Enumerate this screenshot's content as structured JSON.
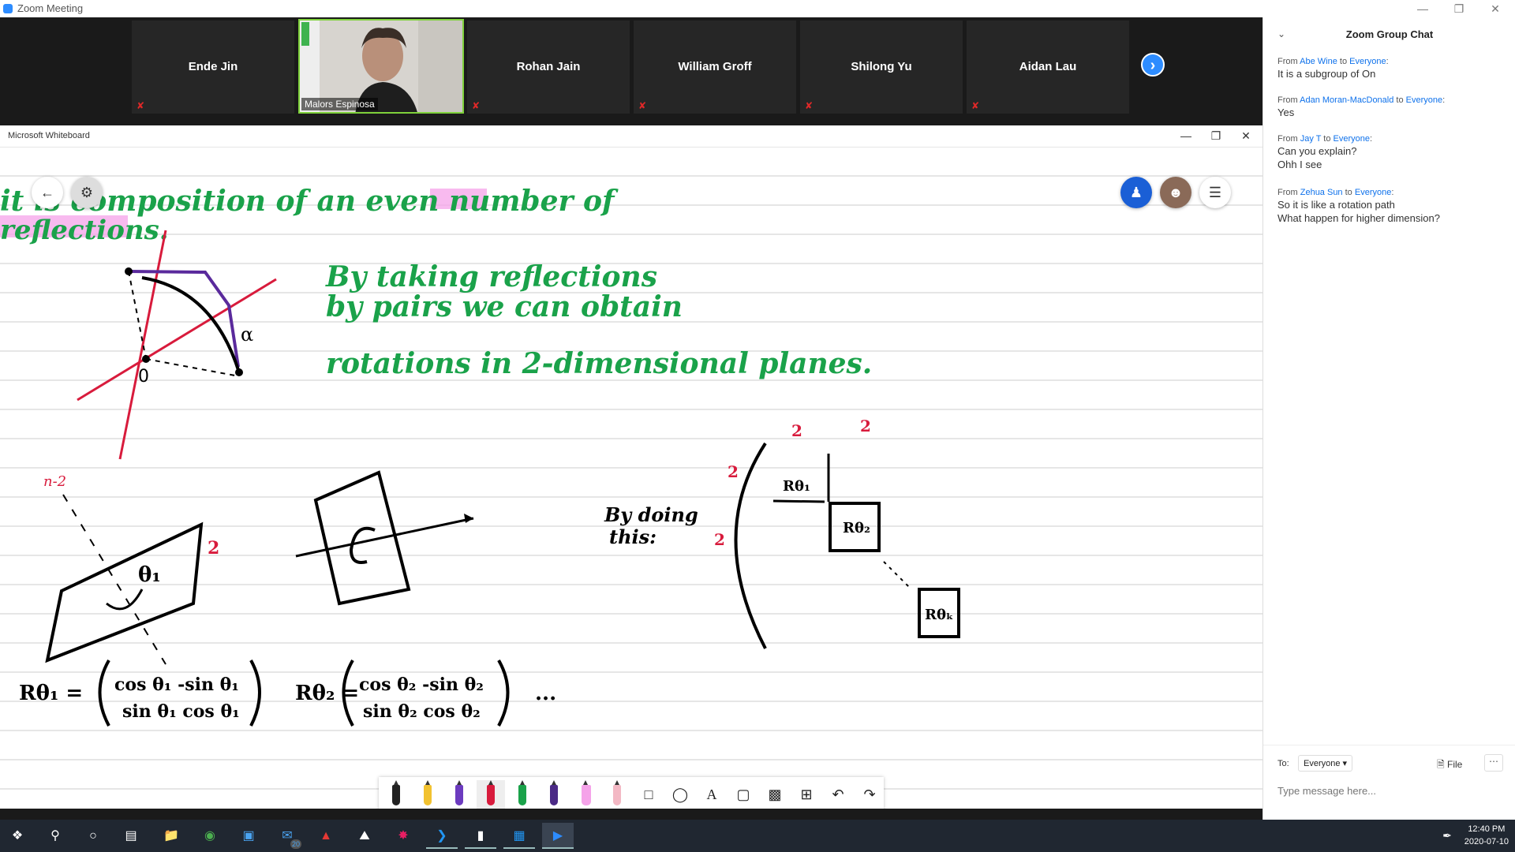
{
  "zoom": {
    "window_title": "Zoom Meeting",
    "participants": [
      {
        "name": "Ende Jin",
        "muted": true
      },
      {
        "name": "Malors Espinosa",
        "muted": false,
        "video": true
      },
      {
        "name": "Rohan Jain",
        "muted": true
      },
      {
        "name": "William Groff",
        "muted": true
      },
      {
        "name": "Shilong Yu",
        "muted": true
      },
      {
        "name": "Aidan Lau",
        "muted": true
      }
    ]
  },
  "whiteboard": {
    "window_title": "Microsoft Whiteboard",
    "ink_green": [
      "it is composition of an even number of",
      "reflections.",
      "By taking reflections",
      "by pairs we can obtain",
      "rotations in 2-dimensional planes."
    ],
    "ink_black": [
      "By doing",
      "this:"
    ],
    "formulas": {
      "r1_label": "Rθ₁ =",
      "r1_row1": "cos θ₁   -sin θ₁",
      "r1_row2": "sin θ₁   cos θ₁",
      "r2_label": "Rθ₂ =",
      "r2_row1": "cos θ₂   -sin θ₂",
      "r2_row2": "sin θ₂   cos θ₂",
      "ellipsis": "..."
    },
    "red_annotations": {
      "n_minus_2": "n-2",
      "two_a": "2",
      "two_b": "2",
      "two_c": "2",
      "two_d": "2",
      "two_e": "2",
      "alpha": "α"
    },
    "block_labels": {
      "b1": "Rθ₁",
      "b2": "Rθ₂",
      "bk": "Rθₖ"
    },
    "sketch_labels": {
      "theta": "θ₁",
      "origin": "0"
    }
  },
  "chat": {
    "title": "Zoom Group Chat",
    "messages": [
      {
        "from": "Abe Wine",
        "to": "Everyone",
        "lines": [
          "It is a subgroup of On"
        ]
      },
      {
        "from": "Adan Moran-MacDonald",
        "to": "Everyone",
        "lines": [
          "Yes"
        ]
      },
      {
        "from": "Jay T",
        "to": "Everyone",
        "lines": [
          "Can you explain?",
          "Ohh I see"
        ]
      },
      {
        "from": "Zehua Sun",
        "to": "Everyone",
        "lines": [
          "So it is like a rotation path",
          "What happen for higher dimension?"
        ]
      }
    ],
    "from_prefix": "From",
    "to_word": "to",
    "to_label": "To:",
    "recipient": "Everyone",
    "file_label": "File",
    "input_placeholder": "Type message here..."
  },
  "taskbar": {
    "time": "12:40 PM",
    "date": "2020-07-10",
    "mail_badge": "20"
  }
}
